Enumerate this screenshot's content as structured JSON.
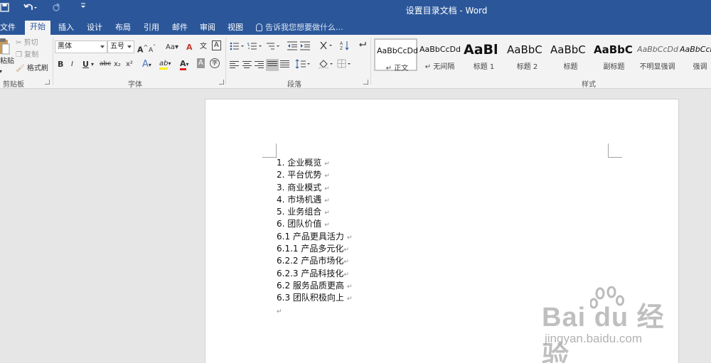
{
  "window": {
    "title": "设置目录文档 - Word"
  },
  "tabs": [
    {
      "label": "文件"
    },
    {
      "label": "开始"
    },
    {
      "label": "插入"
    },
    {
      "label": "设计"
    },
    {
      "label": "布局"
    },
    {
      "label": "引用"
    },
    {
      "label": "邮件"
    },
    {
      "label": "审阅"
    },
    {
      "label": "视图"
    }
  ],
  "tell_me": "告诉我您想要做什么...",
  "clipboard": {
    "paste": "粘贴",
    "cut": "剪切",
    "copy": "复制",
    "format_painter": "格式刷",
    "label": "剪贴板"
  },
  "font": {
    "name": "黑体",
    "size": "五号",
    "label": "字体",
    "aa_case": "Aa",
    "grow": "A",
    "shrink": "A",
    "clear": "A",
    "phonetic": "文",
    "border_char": "A",
    "bold": "B",
    "italic": "I",
    "underline": "U",
    "strike": "abc",
    "sub": "x₂",
    "sup": "x²",
    "effects": "A",
    "highlight": "ab",
    "color": "A",
    "shade": "A",
    "circle": "字"
  },
  "paragraph": {
    "label": "段落"
  },
  "styles": {
    "label": "样式",
    "items": [
      {
        "sample": "AaBbCcDd",
        "name": "↵ 正文"
      },
      {
        "sample": "AaBbCcDd",
        "name": "↵ 无间隔"
      },
      {
        "sample": "AaBl",
        "name": "标题 1"
      },
      {
        "sample": "AaBbC",
        "name": "标题 2"
      },
      {
        "sample": "AaBbC",
        "name": "标题"
      },
      {
        "sample": "AaBbC",
        "name": "副标题"
      },
      {
        "sample": "AaBbCcDd",
        "name": "不明显强调"
      },
      {
        "sample": "AaBbCcDd",
        "name": "强调"
      }
    ]
  },
  "document": {
    "lines": [
      "1. 企业概览",
      "2. 平台优势",
      "3. 商业模式",
      "4. 市场机遇",
      "5. 业务组合",
      "6. 团队价值",
      "6.1 产品更具活力",
      "6.1.1 产品多元化",
      "6.2.2 产品市场化",
      "6.2.3 产品科技化",
      "6.2 服务品质更高",
      "6.3 团队积极向上"
    ],
    "paragraph_mark": "↵"
  },
  "watermark": {
    "brand": "Bai du 经验",
    "url": "jingyan.baidu.com"
  },
  "colors": {
    "title_bar": "#2b579a",
    "ribbon": "#f3f3f3",
    "workspace": "#e6e6e6",
    "font_color_bar": "#e51c23",
    "highlight_bar": "#fff200"
  }
}
